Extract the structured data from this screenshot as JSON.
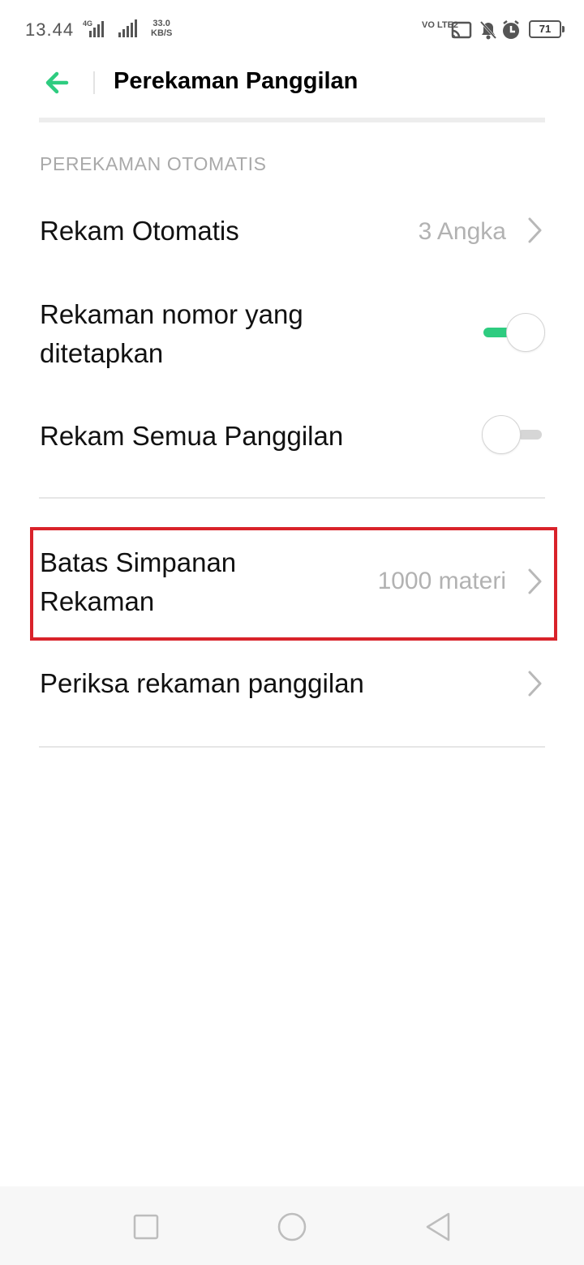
{
  "status_bar": {
    "time": "13.44",
    "network": "4G",
    "speed_value": "33.0",
    "speed_unit": "KB/S",
    "volte": "VO LTE2",
    "battery": "71",
    "icons": [
      "signal-4g-icon",
      "signal-icon",
      "cast-icon",
      "bell-off-icon",
      "alarm-icon",
      "battery-icon"
    ]
  },
  "header": {
    "title": "Perekaman Panggilan",
    "back_icon": "back-arrow-icon"
  },
  "section_header": "PEREKAMAN OTOMATIS",
  "settings": [
    {
      "label": "Rekam Otomatis",
      "value": "3 Angka",
      "type": "link"
    },
    {
      "label": "Rekaman nomor yang ditetapkan",
      "type": "toggle",
      "checked": true
    },
    {
      "label": "Rekam Semua Panggilan",
      "type": "toggle",
      "checked": false
    },
    {
      "label": "Batas Simpanan Rekaman",
      "value": "1000 materi",
      "type": "link",
      "highlighted": true
    },
    {
      "label": "Periksa rekaman panggilan",
      "type": "link"
    }
  ],
  "colors": {
    "accent": "#2ecc80",
    "highlight": "#d9222a",
    "muted_text": "#b2b2b2"
  },
  "nav_bar": {
    "icons": [
      "recents-square-icon",
      "home-circle-icon",
      "back-triangle-icon"
    ]
  }
}
